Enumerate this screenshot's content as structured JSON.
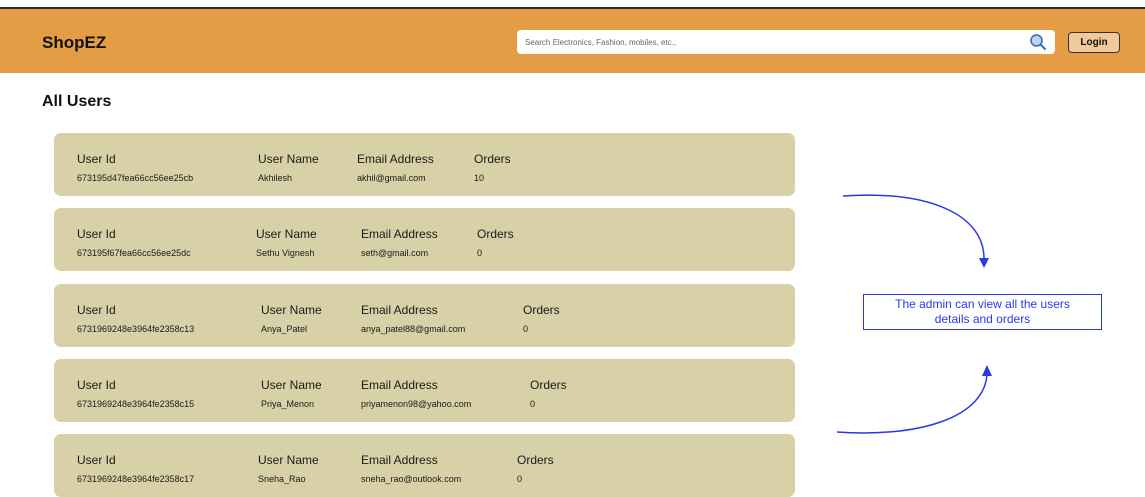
{
  "header": {
    "brand": "ShopEZ",
    "search_placeholder": "Search Electronics, Fashion, mobiles, etc.,",
    "login_label": "Login"
  },
  "page": {
    "title": "All Users"
  },
  "labels": {
    "user_id": "User Id",
    "user_name": "User Name",
    "email": "Email Address",
    "orders": "Orders"
  },
  "users": [
    {
      "id": "673195d47fea66cc56ee25cb",
      "name": "Akhilesh",
      "email": "akhil@gmail.com",
      "orders": "10"
    },
    {
      "id": "673195f67fea66cc56ee25dc",
      "name": "Sethu Vignesh",
      "email": "seth@gmail.com",
      "orders": "0"
    },
    {
      "id": "6731969248e3964fe2358c13",
      "name": "Anya_Patel",
      "email": "anya_patel88@gmail.com",
      "orders": "0"
    },
    {
      "id": "6731969248e3964fe2358c15",
      "name": "Priya_Menon",
      "email": "priyamenon98@yahoo.com",
      "orders": "0"
    },
    {
      "id": "6731969248e3964fe2358c17",
      "name": "Sneha_Rao",
      "email": "sneha_rao@outlook.com",
      "orders": "0"
    }
  ],
  "annotation": {
    "line1": "The admin can view all the users",
    "line2": "details and orders"
  },
  "colors": {
    "header_bg": "#e49d44",
    "card_bg": "#d8d0a6",
    "annotation_blue": "#2a38e6",
    "search_icon": "#3d6fb5"
  }
}
